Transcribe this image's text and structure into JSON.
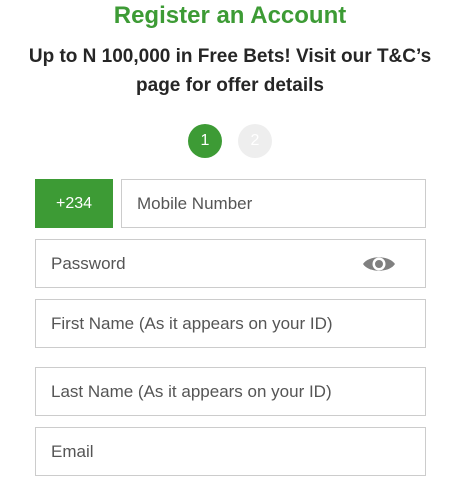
{
  "header": {
    "title": "Register an Account",
    "subtitle": "Up to N 100,000 in Free Bets! Visit our T&C’s page for offer details"
  },
  "steps": [
    {
      "label": "1",
      "active": true
    },
    {
      "label": "2",
      "active": false
    }
  ],
  "form": {
    "country_code": "+234",
    "mobile_placeholder": "Mobile Number",
    "password_placeholder": "Password",
    "first_name_placeholder": "First Name (As it appears on your ID)",
    "last_name_placeholder": "Last Name (As it appears on your ID)",
    "email_placeholder": "Email"
  },
  "icons": {
    "password_toggle": "eye-icon"
  },
  "colors": {
    "accent": "#3d9b35",
    "step_inactive": "#eeeeee",
    "border": "#cccccc",
    "eye": "#808080"
  }
}
